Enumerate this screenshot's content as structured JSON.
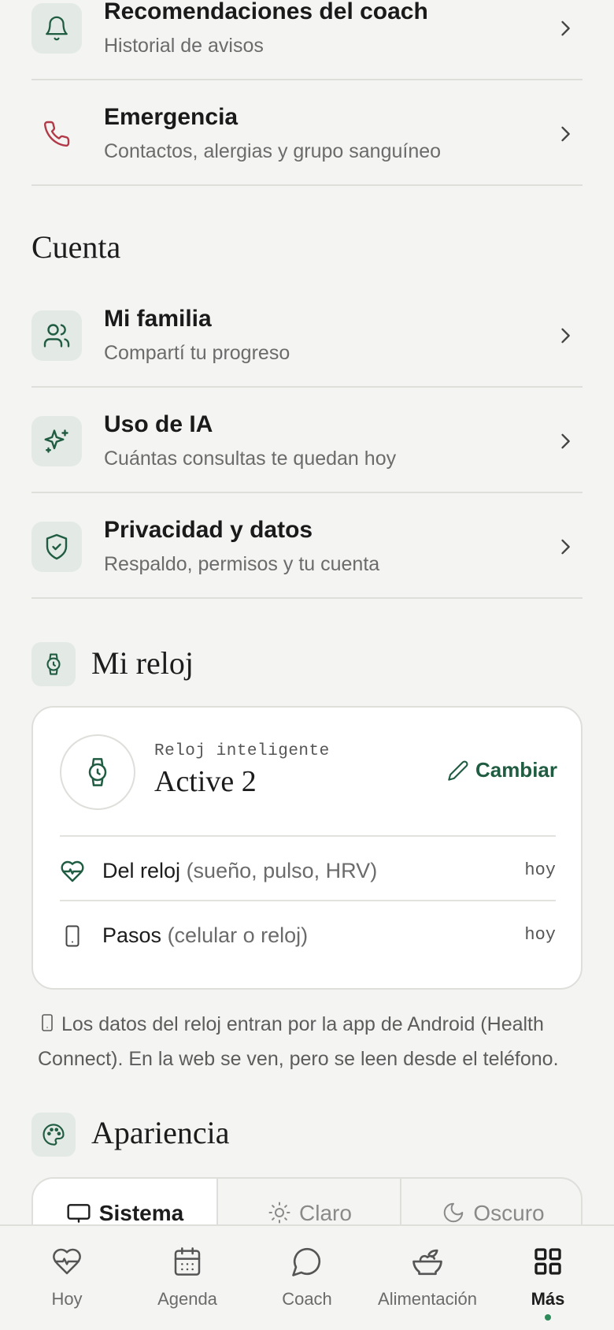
{
  "colors": {
    "accent": "#1f5c41",
    "background": "#f4f4f2",
    "danger": "#b23a48",
    "active_dot": "#2e8a5b"
  },
  "rows_top": [
    {
      "title": "Recomendaciones del coach",
      "subtitle": "Historial de avisos",
      "icon": "bell-icon"
    },
    {
      "title": "Emergencia",
      "subtitle": "Contactos, alergias y grupo sanguíneo",
      "icon": "phone-icon"
    }
  ],
  "account": {
    "section_title": "Cuenta",
    "rows": [
      {
        "title": "Mi familia",
        "subtitle": "Compartí tu progreso",
        "icon": "users-icon"
      },
      {
        "title": "Uso de IA",
        "subtitle": "Cuántas consultas te quedan hoy",
        "icon": "sparkles-icon"
      },
      {
        "title": "Privacidad y datos",
        "subtitle": "Respaldo, permisos y tu cuenta",
        "icon": "shield-check-icon"
      }
    ]
  },
  "watch": {
    "section_title": "Mi reloj",
    "label": "Reloj inteligente",
    "name": "Active 2",
    "change_label": "Cambiar",
    "sources": [
      {
        "main": "Del reloj",
        "detail": "(sueño, pulso, HRV)",
        "when": "hoy",
        "icon": "heart-pulse-icon"
      },
      {
        "main": "Pasos",
        "detail": "(celular o reloj)",
        "when": "hoy",
        "icon": "phone-device-icon"
      }
    ],
    "note": "Los datos del reloj entran por la app de Android (Health Connect). En la web se ven, pero se leen desde el teléfono."
  },
  "appearance": {
    "section_title": "Apariencia",
    "options": [
      {
        "label": "Sistema",
        "icon": "monitor-icon",
        "selected": true
      },
      {
        "label": "Claro",
        "icon": "sun-icon",
        "selected": false
      },
      {
        "label": "Oscuro",
        "icon": "moon-icon",
        "selected": false
      }
    ]
  },
  "nav": [
    {
      "label": "Hoy",
      "icon": "heart-pulse-icon"
    },
    {
      "label": "Agenda",
      "icon": "calendar-icon"
    },
    {
      "label": "Coach",
      "icon": "chat-bubble-icon"
    },
    {
      "label": "Alimentación",
      "icon": "salad-bowl-icon"
    },
    {
      "label": "Más",
      "icon": "grid-icon",
      "active": true
    }
  ]
}
